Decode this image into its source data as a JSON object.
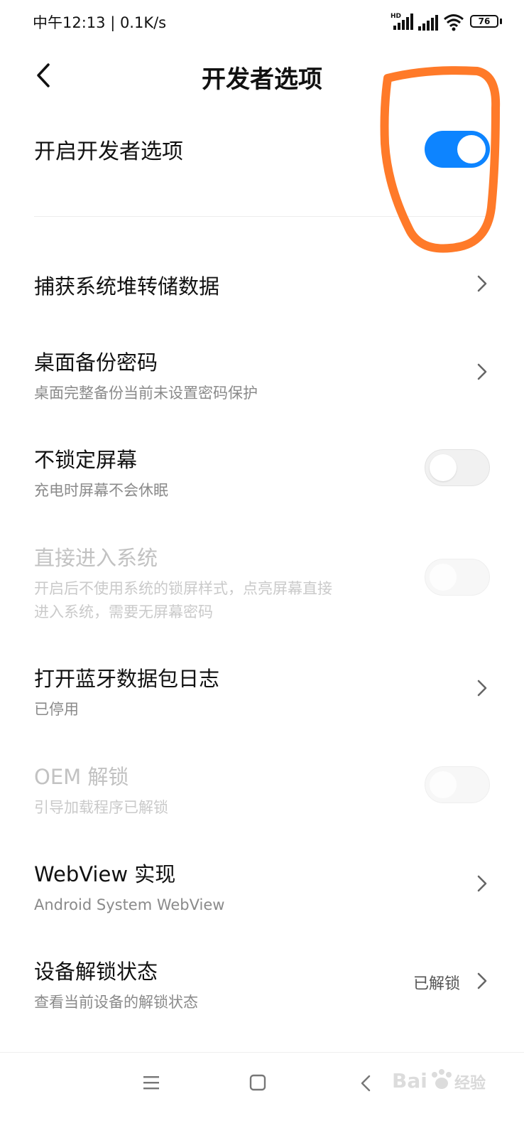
{
  "status_bar": {
    "time_speed": "中午12:13 | 0.1K/s",
    "battery": "76",
    "icons": [
      "hd-signal-icon",
      "signal-icon",
      "wifi-icon",
      "battery-icon"
    ]
  },
  "header": {
    "title": "开发者选项",
    "back_icon": "back-arrow-icon"
  },
  "master_toggle": {
    "label": "开启开发者选项",
    "state": "on"
  },
  "settings": [
    {
      "title": "捕获系统堆转储数据",
      "subtitle": "",
      "control": "chevron"
    },
    {
      "title": "桌面备份密码",
      "subtitle": "桌面完整备份当前未设置密码保护",
      "control": "chevron"
    },
    {
      "title": "不锁定屏幕",
      "subtitle": "充电时屏幕不会休眠",
      "control": "toggle",
      "state": "off"
    },
    {
      "title": "直接进入系统",
      "subtitle_line1": "开启后不使用系统的锁屏样式，点亮屏幕直接",
      "subtitle_line2": "进入系统，需要无屏幕密码",
      "control": "toggle",
      "state": "off",
      "disabled": true
    },
    {
      "title": "打开蓝牙数据包日志",
      "subtitle": "已停用",
      "control": "chevron"
    },
    {
      "title": "OEM 解锁",
      "subtitle": "引导加载程序已解锁",
      "control": "toggle",
      "state": "off",
      "disabled": true
    },
    {
      "title": "WebView 实现",
      "subtitle": "Android System WebView",
      "control": "chevron"
    },
    {
      "title": "设备解锁状态",
      "subtitle": "查看当前设备的解锁状态",
      "value": "已解锁",
      "control": "chevron"
    }
  ],
  "nav_bar": {
    "icons": [
      "menu-icon",
      "home-icon",
      "back-icon"
    ]
  },
  "watermark": {
    "text": "经验",
    "logo": "baidu-paw-logo"
  },
  "colors": {
    "accent": "#0d84ff",
    "annotation": "#ff7a29",
    "subtitle": "#8a8a8a",
    "disabled": "#c2c2c2"
  }
}
